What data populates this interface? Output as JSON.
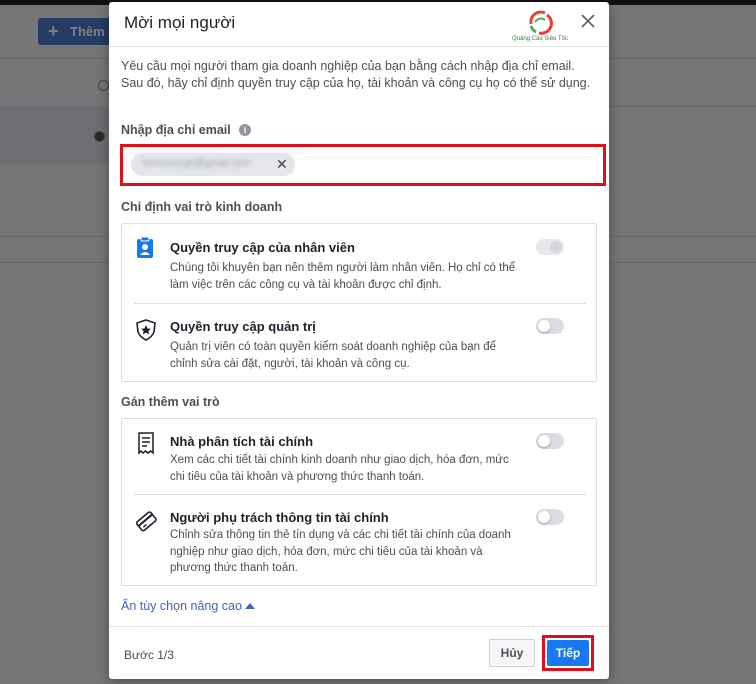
{
  "background": {
    "add_button_label": "Thêm"
  },
  "modal": {
    "title": "Mời mọi người",
    "logo_text": "Quảng Cáo Siêu Tốc",
    "intro": "Yêu cầu mọi người tham gia doanh nghiệp của bạn bằng cách nhập địa chỉ email. Sau đó, hãy chỉ định quyền truy cập của họ, tài khoản và công cụ họ có thể sử dụng.",
    "email_label": "Nhập địa chỉ email",
    "email_chip": "binhcuongh@gmail.com",
    "business_role_title": "Chỉ định vai trò kinh doanh",
    "business_roles": [
      {
        "title": "Quyền truy cập của nhân viên",
        "description": "Chúng tôi khuyên bạn nên thêm người làm nhân viên. Họ chỉ có thể làm việc trên các công cụ và tài khoản được chỉ định.",
        "toggle_on": false,
        "disabled": true,
        "icon": "employee-badge-icon"
      },
      {
        "title": "Quyền truy cập quản trị",
        "description": "Quản trị viên có toàn quyền kiểm soát doanh nghiệp của bạn để chỉnh sửa cài đặt, người, tài khoản và công cụ.",
        "toggle_on": false,
        "disabled": false,
        "icon": "admin-shield-icon"
      }
    ],
    "extra_role_title": "Gán thêm vai trò",
    "extra_roles": [
      {
        "title": "Nhà phân tích tài chính",
        "description": "Xem các chi tiết tài chính kinh doanh như giao dịch, hóa đơn, mức chi tiêu của tài khoản và phương thức thanh toán.",
        "toggle_on": false,
        "icon": "receipt-icon"
      },
      {
        "title": "Người phụ trách thông tin tài chính",
        "description": "Chỉnh sửa thông tin thẻ tín dụng và các chi tiết tài chính của doanh nghiệp như giao dịch, hóa đơn, mức chi tiêu của tài khoản và phương thức thanh toán.",
        "toggle_on": false,
        "icon": "credit-card-icon"
      }
    ],
    "advanced_link": "Ẩn tùy chọn nâng cao",
    "step": "Bước 1/3",
    "cancel_label": "Hủy",
    "next_label": "Tiếp"
  },
  "colors": {
    "primary": "#1877f2",
    "link": "#4267b2",
    "highlight": "#e0101a"
  }
}
